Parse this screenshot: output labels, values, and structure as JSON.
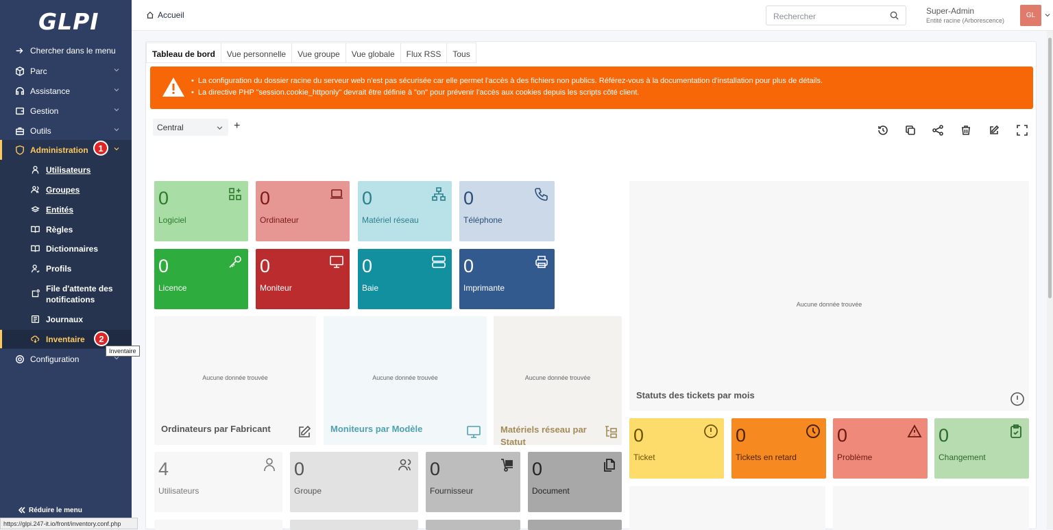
{
  "sidebar": {
    "logo": "GLPI",
    "items": [
      {
        "label": "Chercher dans le menu",
        "icon": "arrow-right-icon"
      },
      {
        "label": "Parc",
        "icon": "box-icon"
      },
      {
        "label": "Assistance",
        "icon": "headset-icon"
      },
      {
        "label": "Gestion",
        "icon": "wallet-icon"
      },
      {
        "label": "Outils",
        "icon": "briefcase-icon"
      },
      {
        "label": "Administration",
        "icon": "shield-icon"
      },
      {
        "label": "Configuration",
        "icon": "gear-icon"
      }
    ],
    "submenu": [
      {
        "label": "Utilisateurs",
        "icon": "user-icon"
      },
      {
        "label": "Groupes",
        "icon": "users-icon"
      },
      {
        "label": "Entités",
        "icon": "stack-icon"
      },
      {
        "label": "Règles",
        "icon": "book-icon"
      },
      {
        "label": "Dictionnaires",
        "icon": "book-icon"
      },
      {
        "label": "Profils",
        "icon": "user-check-icon"
      },
      {
        "label": "File d'attente des notifications",
        "icon": "notification-icon"
      },
      {
        "label": "Journaux",
        "icon": "news-icon"
      },
      {
        "label": "Inventaire",
        "icon": "cloud-download-icon"
      }
    ],
    "badges": [
      "1",
      "2"
    ],
    "reduce_label": "Réduire le menu",
    "tooltip": "Inventaire",
    "status_url": "https://glpi.247-it.io/front/inventory.conf.php"
  },
  "topbar": {
    "breadcrumb": "Accueil",
    "search_placeholder": "Rechercher",
    "user_name": "Super-Admin",
    "user_entity": "Entité racine (Arborescence)",
    "avatar": "GL"
  },
  "tabs": [
    "Tableau de bord",
    "Vue personnelle",
    "Vue groupe",
    "Vue globale",
    "Flux RSS",
    "Tous"
  ],
  "alert": {
    "lines": [
      "La configuration du dossier racine du serveur web n'est pas sécurisée car elle permet l'accès à des fichiers non publics. Référez-vous à la documentation d'installation pour plus de détails.",
      "La directive PHP \"session.cookie_httponly\" devrait être définie à \"on\" pour prévenir l'accès aux cookies depuis les scripts côté client."
    ]
  },
  "dashboard": {
    "selected": "Central",
    "tools": [
      "history-icon",
      "copy-icon",
      "share-icon",
      "trash-icon",
      "edit-icon",
      "fullscreen-icon"
    ]
  },
  "cards_row1": [
    {
      "value": "0",
      "label": "Logiciel",
      "bg": "#a9dda6",
      "fg": "#2d7a2b",
      "icon": "apps-plus-icon"
    },
    {
      "value": "0",
      "label": "Ordinateur",
      "bg": "#e79793",
      "fg": "#7a1a17",
      "icon": "laptop-icon"
    },
    {
      "value": "0",
      "label": "Matériel réseau",
      "bg": "#b9e2e8",
      "fg": "#2b7f8c",
      "icon": "network-icon"
    },
    {
      "value": "0",
      "label": "Téléphone",
      "bg": "#cbd9e8",
      "fg": "#2b4d78",
      "icon": "phone-icon"
    }
  ],
  "cards_row2": [
    {
      "value": "0",
      "label": "Licence",
      "bg": "#2fac3e",
      "fg": "#ffffff",
      "icon": "key-icon"
    },
    {
      "value": "0",
      "label": "Moniteur",
      "bg": "#bb2c2f",
      "fg": "#ffffff",
      "icon": "monitor-icon"
    },
    {
      "value": "0",
      "label": "Baie",
      "bg": "#13909f",
      "fg": "#ffffff",
      "icon": "server-icon"
    },
    {
      "value": "0",
      "label": "Imprimante",
      "bg": "#335a8f",
      "fg": "#ffffff",
      "icon": "printer-icon"
    }
  ],
  "charts": [
    {
      "title": "Ordinateurs par Fabricant",
      "nodata": "Aucune donnée trouvée",
      "bg": "#f7f7f8",
      "fg": "#555555",
      "icon": "edit-icon"
    },
    {
      "title": "Moniteurs par Modèle",
      "nodata": "Aucune donnée trouvée",
      "bg": "#f2f8f9",
      "fg": "#4fa0b1",
      "icon": "monitor-icon"
    },
    {
      "title": "Matériels réseau par Statut",
      "nodata": "Aucune donnée trouvée",
      "bg": "#f3f2ee",
      "fg": "#a38b59",
      "icon": "hierarchy-icon"
    }
  ],
  "tickets_chart": {
    "title": "Statuts des tickets par mois",
    "nodata": "Aucune donnée trouvée",
    "icon": "alert-circle-icon"
  },
  "cards_row3": [
    {
      "value": "4",
      "label": "Utilisateurs",
      "bg": "#f7f7f8",
      "fg": "#777777",
      "icon": "user-icon"
    },
    {
      "value": "0",
      "label": "Groupe",
      "bg": "#e2e2e2",
      "fg": "#555555",
      "icon": "users-icon"
    },
    {
      "value": "0",
      "label": "Fournisseur",
      "bg": "#bdbdbd",
      "fg": "#333333",
      "icon": "dolly-icon"
    },
    {
      "value": "0",
      "label": "Document",
      "bg": "#a8a8a8",
      "fg": "#222222",
      "icon": "files-icon"
    }
  ],
  "ticket_cards": [
    {
      "value": "0",
      "label": "Ticket",
      "bg": "#fddc6b",
      "fg": "#6b5300",
      "icon": "alert-circle-icon"
    },
    {
      "value": "0",
      "label": "Tickets en retard",
      "bg": "#f6891f",
      "fg": "#4a2300",
      "icon": "clock-icon"
    },
    {
      "value": "0",
      "label": "Problème",
      "bg": "#ef8a7a",
      "fg": "#6a1a12",
      "icon": "alert-triangle-icon"
    },
    {
      "value": "0",
      "label": "Changement",
      "bg": "#b7dcb0",
      "fg": "#2d6a2b",
      "icon": "clipboard-check-icon"
    }
  ]
}
